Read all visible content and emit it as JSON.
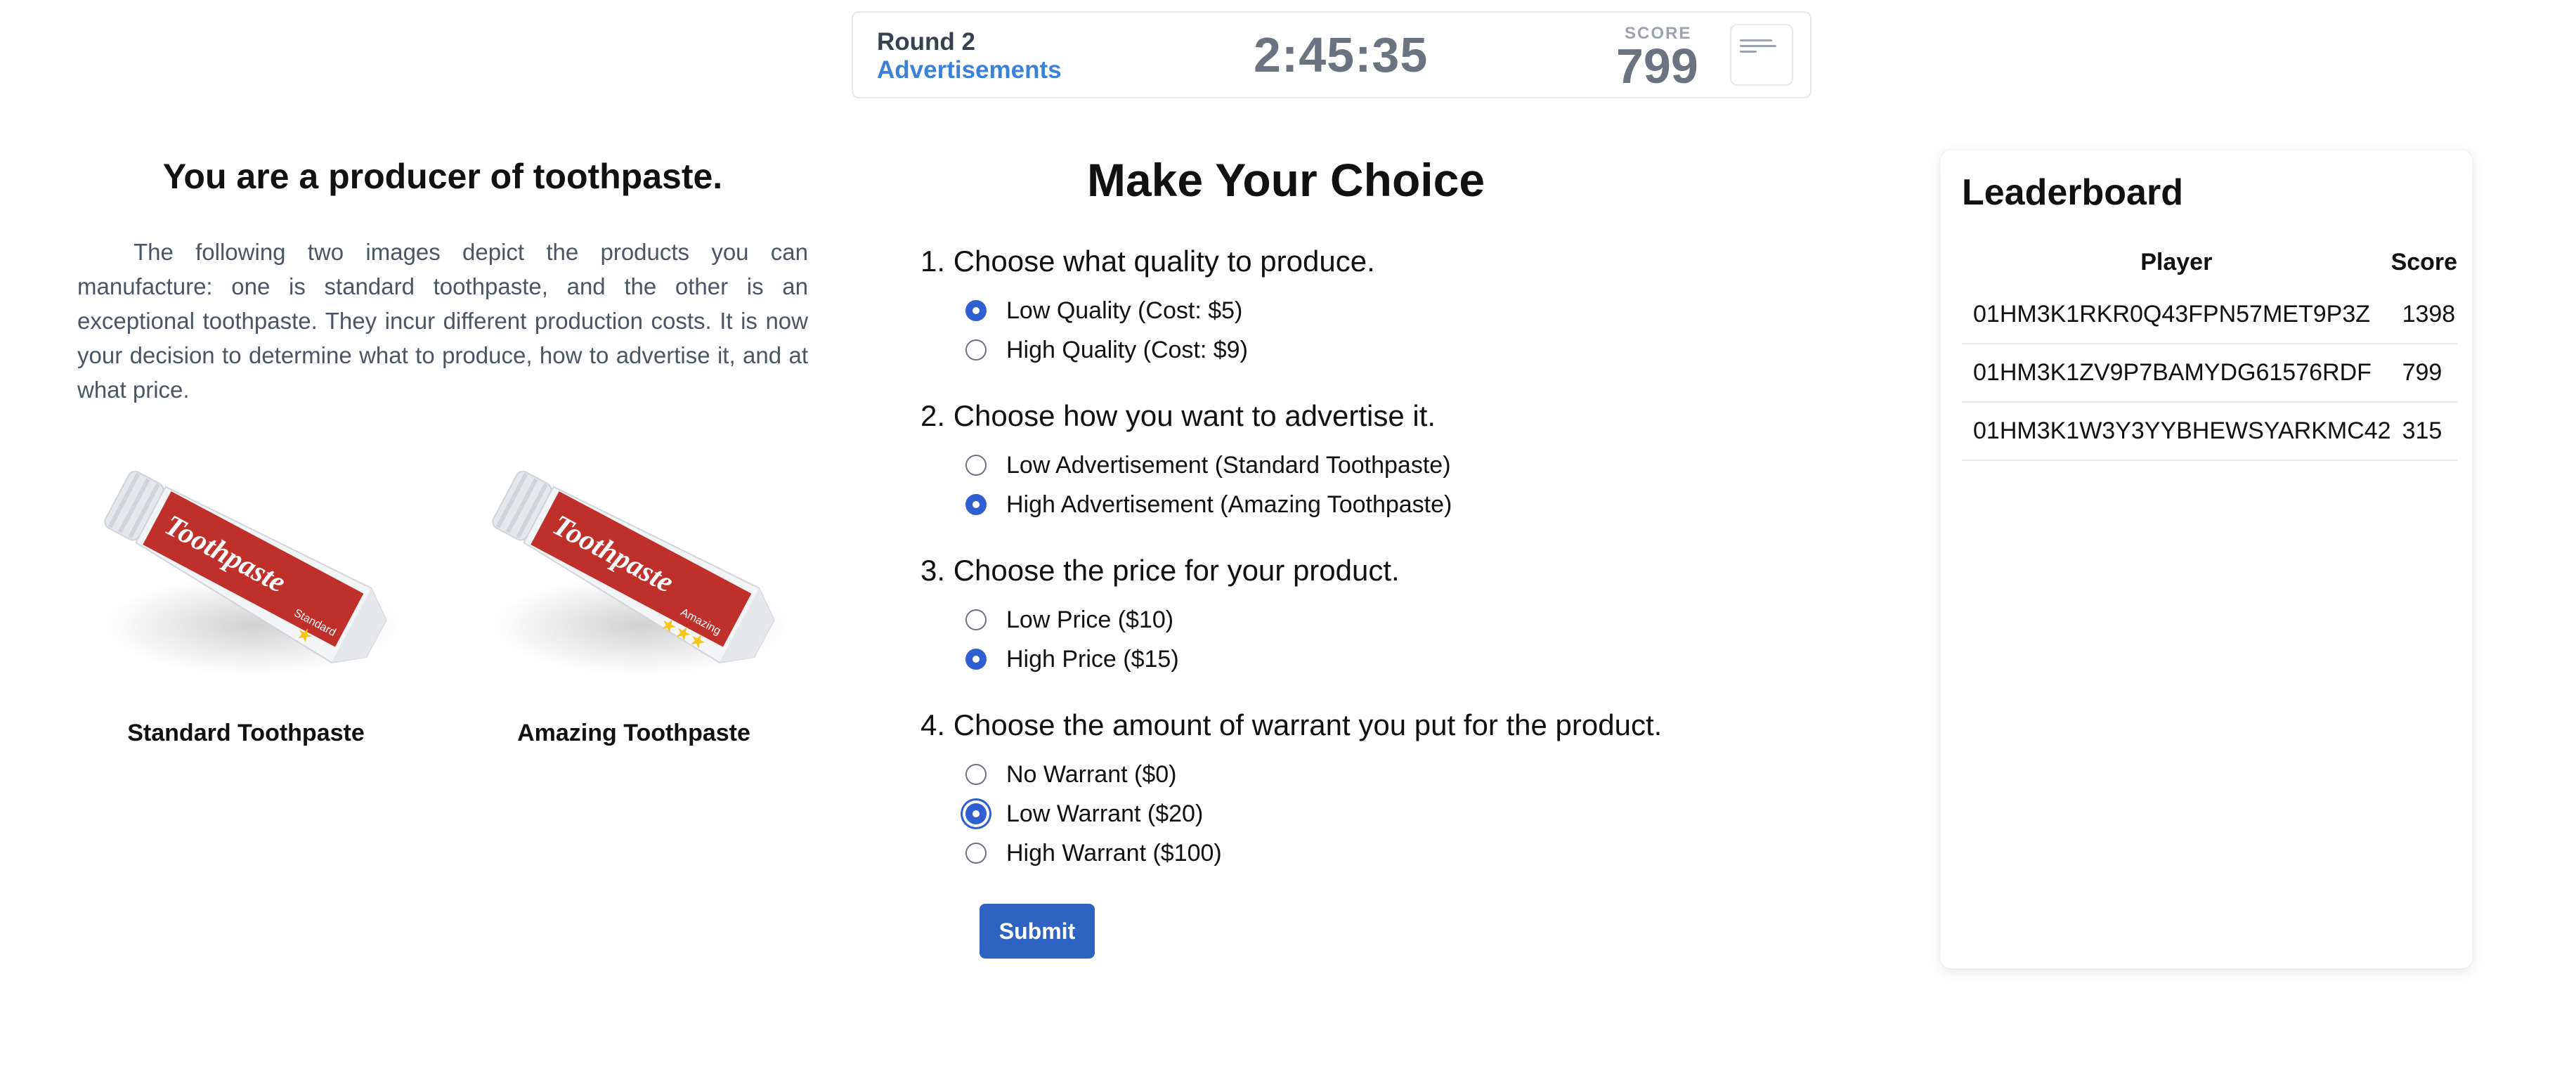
{
  "header": {
    "round": "Round 2",
    "stage": "Advertisements",
    "timer": "2:45:35",
    "score_caption": "SCORE",
    "score": "799"
  },
  "intro": {
    "title": "You are a producer of toothpaste.",
    "text": "The following two images depict the products you can manufacture: one is standard toothpaste, and the other is an exceptional toothpaste. They incur different production costs. It is now your decision to determine what to produce, how to advertise it, and at what price."
  },
  "products": [
    {
      "caption": "Standard Toothpaste",
      "tube_text": "Toothpaste",
      "badge": "Standard",
      "stars": "★",
      "tube_color": "#c0302b"
    },
    {
      "caption": "Amazing Toothpaste",
      "tube_text": "Toothpaste",
      "badge": "Amazing",
      "stars": "★★★",
      "tube_color": "#c0302b"
    }
  ],
  "form": {
    "title": "Make Your Choice",
    "questions": [
      {
        "label": "1. Choose what quality to produce.",
        "options": [
          {
            "label": "Low Quality (Cost: $5)",
            "selected": true
          },
          {
            "label": "High Quality (Cost: $9)",
            "selected": false
          }
        ]
      },
      {
        "label": "2. Choose how you want to advertise it.",
        "options": [
          {
            "label": "Low Advertisement (Standard Toothpaste)",
            "selected": false
          },
          {
            "label": "High Advertisement (Amazing Toothpaste)",
            "selected": true
          }
        ]
      },
      {
        "label": "3. Choose the price for your product.",
        "options": [
          {
            "label": "Low Price ($10)",
            "selected": false
          },
          {
            "label": "High Price ($15)",
            "selected": true
          }
        ]
      },
      {
        "label": "4. Choose the amount of warrant you put for the product.",
        "options": [
          {
            "label": "No Warrant ($0)",
            "selected": false
          },
          {
            "label": "Low Warrant ($20)",
            "selected": true
          },
          {
            "label": "High Warrant ($100)",
            "selected": false
          }
        ]
      }
    ],
    "submit_label": "Submit"
  },
  "leaderboard": {
    "title": "Leaderboard",
    "columns": [
      "Player",
      "Score"
    ],
    "rows": [
      {
        "player": "01HM3K1RKR0Q43FPN57MET9P3Z",
        "score": "1398"
      },
      {
        "player": "01HM3K1ZV9P7BAMYDG61576RDF",
        "score": "799"
      },
      {
        "player": "01HM3K1W3Y3YYBHEWSYARKMC42",
        "score": "315"
      }
    ]
  },
  "colors": {
    "accent": "#2f5fd0",
    "stage_link": "#3b82d6",
    "button": "#2f63c2"
  }
}
